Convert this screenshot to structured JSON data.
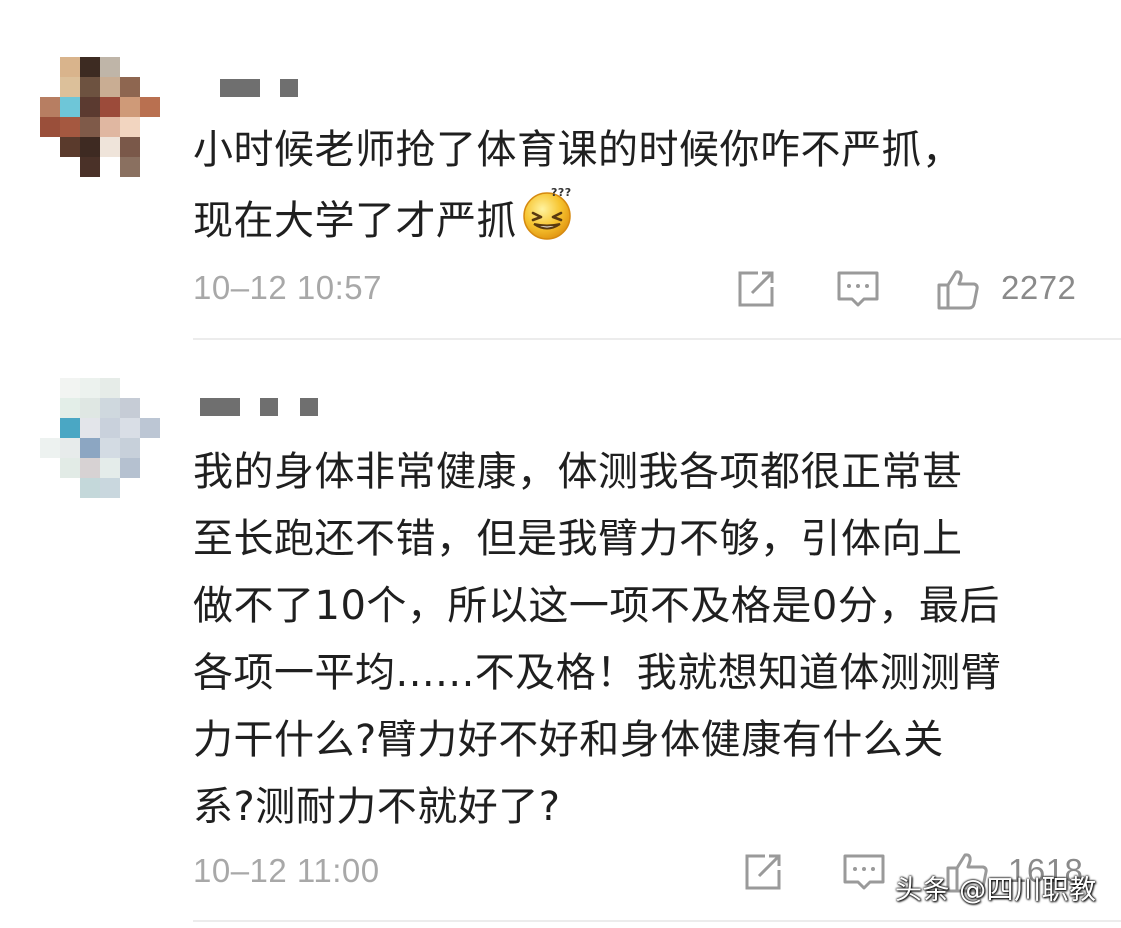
{
  "comments": [
    {
      "avatar_colors": [
        [
          "#ffffff",
          "#d9b48c",
          "#3d2b22",
          "#bfb5a8",
          "#ffffff",
          "#ffffff"
        ],
        [
          "#ffffff",
          "#dcc09a",
          "#6d5240",
          "#c9ad93",
          "#8e6650",
          "#ffffff"
        ],
        [
          "#b77e62",
          "#6ec6d8",
          "#5b3a30",
          "#9c4b3a",
          "#cf9a78",
          "#b97050"
        ],
        [
          "#9a4f3a",
          "#a55840",
          "#7f5a49",
          "#e0b7a1",
          "#f2d5c0",
          "#ffffff"
        ],
        [
          "#ffffff",
          "#5a3a2c",
          "#3e2a22",
          "#efe4da",
          "#7a5849",
          "#ffffff"
        ],
        [
          "#ffffff",
          "#ffffff",
          "#4a3128",
          "#ffffff",
          "#8a7060",
          "#ffffff"
        ]
      ],
      "content": "小时候老师抢了体育课的时候你咋不严抓，\n现在大学了才严抓",
      "emoji_icon": "squinting-face-with-question-marks",
      "timestamp": "10–12 10:57",
      "like_count": "2272"
    },
    {
      "avatar_colors": [
        [
          "#ffffff",
          "#f2f4f2",
          "#ecf2ee",
          "#e6ece8",
          "#ffffff",
          "#ffffff"
        ],
        [
          "#ffffff",
          "#e3eee8",
          "#dfe7e3",
          "#cfd8de",
          "#c6ccd6",
          "#ffffff"
        ],
        [
          "#ffffff",
          "#4aa7c4",
          "#e3e5ea",
          "#c9d1dc",
          "#d9dee6",
          "#bcc6d4"
        ],
        [
          "#edf2f0",
          "#e7ebeb",
          "#8ca6c2",
          "#d3dbe3",
          "#c7d0da",
          "#ffffff"
        ],
        [
          "#ffffff",
          "#e2ebe6",
          "#d7d2d3",
          "#e4ecea",
          "#b5c1d0",
          "#ffffff"
        ],
        [
          "#ffffff",
          "#ffffff",
          "#c4d8da",
          "#c9d7de",
          "#ffffff",
          "#ffffff"
        ]
      ],
      "content": "我的身体非常健康，体测我各项都很正常甚\n至长跑还不错，但是我臂力不够，引体向上\n做不了10个，所以这一项不及格是0分，最后\n各项一平均......不及格！我就想知道体测测臂\n力干什么?臂力好不好和身体健康有什么关\n系?测耐力不就好了?",
      "timestamp": "10–12 11:00",
      "like_count": "1618"
    }
  ],
  "icons": {
    "share": "share-icon",
    "reply": "comment-icon",
    "like": "thumbs-up-icon"
  },
  "colors": {
    "meta_text": "#a8a8a8",
    "divider": "#ececec"
  },
  "watermark": "头条 @四川职教"
}
